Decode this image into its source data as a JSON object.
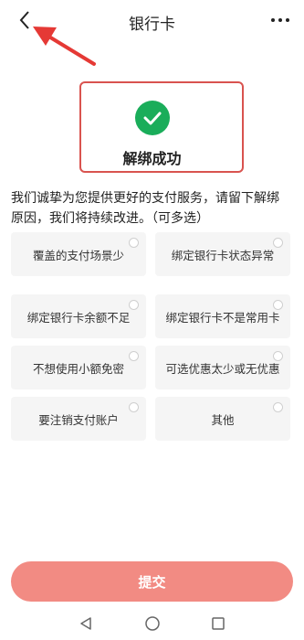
{
  "header": {
    "title": "银行卡"
  },
  "success": {
    "text": "解绑成功"
  },
  "reason": {
    "description": "我们诚挚为您提供更好的支付服务，请留下解绑原因，我们将持续改进。（可多选）"
  },
  "options": [
    {
      "label": "覆盖的支付场景少"
    },
    {
      "label": "绑定银行卡状态异常"
    },
    {
      "label": "绑定银行卡余额不足"
    },
    {
      "label": "绑定银行卡不是常用卡"
    },
    {
      "label": "不想使用小额免密"
    },
    {
      "label": "可选优惠太少或无优惠"
    },
    {
      "label": "要注销支付账户"
    },
    {
      "label": "其他"
    }
  ],
  "submit": {
    "label": "提交"
  },
  "colors": {
    "accent": "#f28b83",
    "success": "#1aad5a",
    "annotation": "#e53935"
  },
  "icons": [
    "back-icon",
    "more-icon",
    "check-icon",
    "nav-back-icon",
    "nav-home-icon",
    "nav-recent-icon"
  ]
}
